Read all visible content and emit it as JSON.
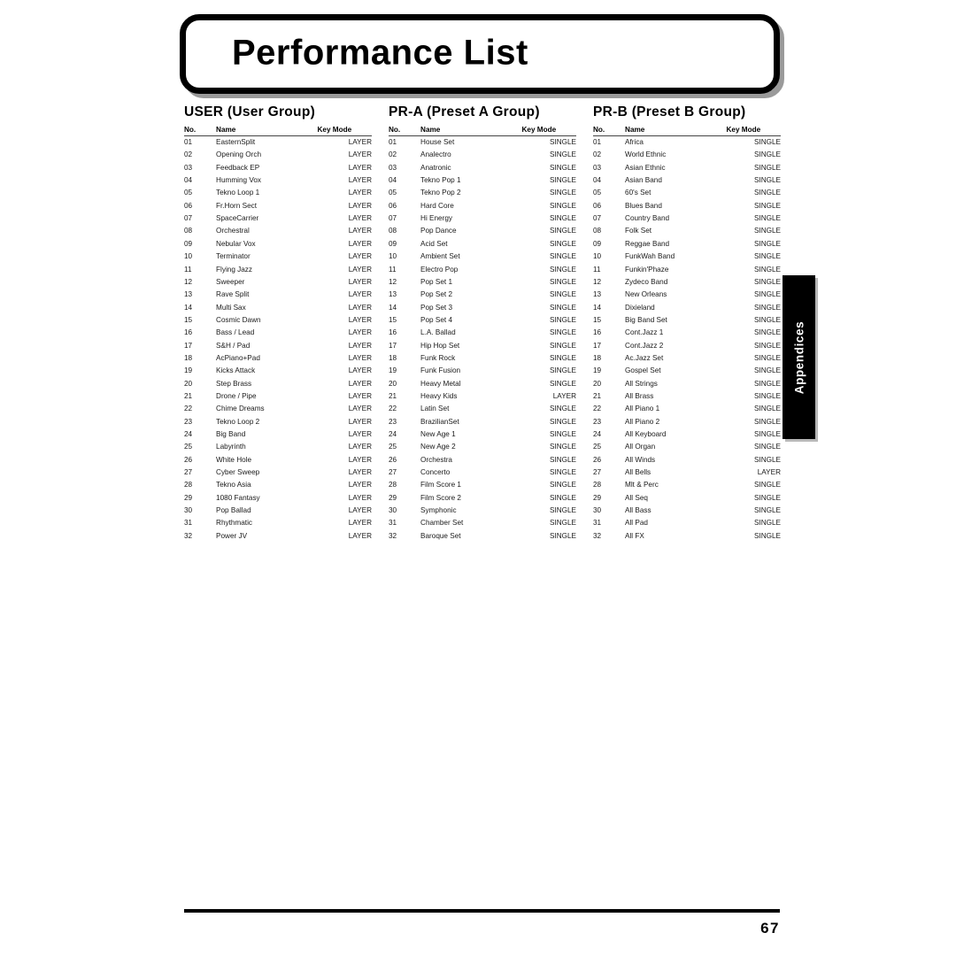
{
  "page": {
    "title": "Performance List",
    "side_tab_label": "Appendices",
    "page_number": "67"
  },
  "table_headers": {
    "no": "No.",
    "name": "Name",
    "key_mode": "Key Mode"
  },
  "groups": [
    {
      "id": "user",
      "title": "USER (User Group)",
      "rows": [
        {
          "no": "01",
          "name": "EasternSplit",
          "key": "LAYER"
        },
        {
          "no": "02",
          "name": "Opening Orch",
          "key": "LAYER"
        },
        {
          "no": "03",
          "name": "Feedback EP",
          "key": "LAYER"
        },
        {
          "no": "04",
          "name": "Humming Vox",
          "key": "LAYER"
        },
        {
          "no": "05",
          "name": "Tekno Loop 1",
          "key": "LAYER"
        },
        {
          "no": "06",
          "name": "Fr.Horn Sect",
          "key": "LAYER"
        },
        {
          "no": "07",
          "name": "SpaceCarrier",
          "key": "LAYER"
        },
        {
          "no": "08",
          "name": "Orchestral",
          "key": "LAYER"
        },
        {
          "no": "09",
          "name": "Nebular Vox",
          "key": "LAYER"
        },
        {
          "no": "10",
          "name": "Terminator",
          "key": "LAYER"
        },
        {
          "no": "11",
          "name": "Flying Jazz",
          "key": "LAYER"
        },
        {
          "no": "12",
          "name": "Sweeper",
          "key": "LAYER"
        },
        {
          "no": "13",
          "name": "Rave Split",
          "key": "LAYER"
        },
        {
          "no": "14",
          "name": "Multi Sax",
          "key": "LAYER"
        },
        {
          "no": "15",
          "name": "Cosmic Dawn",
          "key": "LAYER"
        },
        {
          "no": "16",
          "name": "Bass / Lead",
          "key": "LAYER"
        },
        {
          "no": "17",
          "name": "S&H / Pad",
          "key": "LAYER"
        },
        {
          "no": "18",
          "name": "AcPiano+Pad",
          "key": "LAYER"
        },
        {
          "no": "19",
          "name": "Kicks Attack",
          "key": "LAYER"
        },
        {
          "no": "20",
          "name": "Step Brass",
          "key": "LAYER"
        },
        {
          "no": "21",
          "name": "Drone / Pipe",
          "key": "LAYER"
        },
        {
          "no": "22",
          "name": "Chime Dreams",
          "key": "LAYER"
        },
        {
          "no": "23",
          "name": "Tekno Loop 2",
          "key": "LAYER"
        },
        {
          "no": "24",
          "name": "Big Band",
          "key": "LAYER"
        },
        {
          "no": "25",
          "name": "Labyrinth",
          "key": "LAYER"
        },
        {
          "no": "26",
          "name": "White Hole",
          "key": "LAYER"
        },
        {
          "no": "27",
          "name": "Cyber Sweep",
          "key": "LAYER"
        },
        {
          "no": "28",
          "name": "Tekno Asia",
          "key": "LAYER"
        },
        {
          "no": "29",
          "name": "1080 Fantasy",
          "key": "LAYER"
        },
        {
          "no": "30",
          "name": "Pop Ballad",
          "key": "LAYER"
        },
        {
          "no": "31",
          "name": "Rhythmatic",
          "key": "LAYER"
        },
        {
          "no": "32",
          "name": "Power JV",
          "key": "LAYER"
        }
      ]
    },
    {
      "id": "pr-a",
      "title": "PR-A (Preset A Group)",
      "rows": [
        {
          "no": "01",
          "name": "House Set",
          "key": "SINGLE"
        },
        {
          "no": "02",
          "name": "Analectro",
          "key": "SINGLE"
        },
        {
          "no": "03",
          "name": "Anatronic",
          "key": "SINGLE"
        },
        {
          "no": "04",
          "name": "Tekno Pop 1",
          "key": "SINGLE"
        },
        {
          "no": "05",
          "name": "Tekno Pop 2",
          "key": "SINGLE"
        },
        {
          "no": "06",
          "name": "Hard Core",
          "key": "SINGLE"
        },
        {
          "no": "07",
          "name": "Hi Energy",
          "key": "SINGLE"
        },
        {
          "no": "08",
          "name": "Pop Dance",
          "key": "SINGLE"
        },
        {
          "no": "09",
          "name": "Acid Set",
          "key": "SINGLE"
        },
        {
          "no": "10",
          "name": "Ambient Set",
          "key": "SINGLE"
        },
        {
          "no": "11",
          "name": "Electro Pop",
          "key": "SINGLE"
        },
        {
          "no": "12",
          "name": "Pop Set 1",
          "key": "SINGLE"
        },
        {
          "no": "13",
          "name": "Pop Set 2",
          "key": "SINGLE"
        },
        {
          "no": "14",
          "name": "Pop Set 3",
          "key": "SINGLE"
        },
        {
          "no": "15",
          "name": "Pop Set 4",
          "key": "SINGLE"
        },
        {
          "no": "16",
          "name": "L.A. Ballad",
          "key": "SINGLE"
        },
        {
          "no": "17",
          "name": "Hip Hop Set",
          "key": "SINGLE"
        },
        {
          "no": "18",
          "name": "Funk Rock",
          "key": "SINGLE"
        },
        {
          "no": "19",
          "name": "Funk Fusion",
          "key": "SINGLE"
        },
        {
          "no": "20",
          "name": "Heavy Metal",
          "key": "SINGLE"
        },
        {
          "no": "21",
          "name": "Heavy Kids",
          "key": "LAYER"
        },
        {
          "no": "22",
          "name": "Latin Set",
          "key": "SINGLE"
        },
        {
          "no": "23",
          "name": "BrazilianSet",
          "key": "SINGLE"
        },
        {
          "no": "24",
          "name": "New Age 1",
          "key": "SINGLE"
        },
        {
          "no": "25",
          "name": "New Age 2",
          "key": "SINGLE"
        },
        {
          "no": "26",
          "name": "Orchestra",
          "key": "SINGLE"
        },
        {
          "no": "27",
          "name": "Concerto",
          "key": "SINGLE"
        },
        {
          "no": "28",
          "name": "Film Score 1",
          "key": "SINGLE"
        },
        {
          "no": "29",
          "name": "Film Score 2",
          "key": "SINGLE"
        },
        {
          "no": "30",
          "name": "Symphonic",
          "key": "SINGLE"
        },
        {
          "no": "31",
          "name": "Chamber Set",
          "key": "SINGLE"
        },
        {
          "no": "32",
          "name": "Baroque Set",
          "key": "SINGLE"
        }
      ]
    },
    {
      "id": "pr-b",
      "title": "PR-B (Preset B Group)",
      "rows": [
        {
          "no": "01",
          "name": "Africa",
          "key": "SINGLE"
        },
        {
          "no": "02",
          "name": "World Ethnic",
          "key": "SINGLE"
        },
        {
          "no": "03",
          "name": "Asian Ethnic",
          "key": "SINGLE"
        },
        {
          "no": "04",
          "name": "Asian Band",
          "key": "SINGLE"
        },
        {
          "no": "05",
          "name": "60's Set",
          "key": "SINGLE"
        },
        {
          "no": "06",
          "name": "Blues Band",
          "key": "SINGLE"
        },
        {
          "no": "07",
          "name": "Country Band",
          "key": "SINGLE"
        },
        {
          "no": "08",
          "name": "Folk Set",
          "key": "SINGLE"
        },
        {
          "no": "09",
          "name": "Reggae Band",
          "key": "SINGLE"
        },
        {
          "no": "10",
          "name": "FunkWah Band",
          "key": "SINGLE"
        },
        {
          "no": "11",
          "name": "Funkin'Phaze",
          "key": "SINGLE"
        },
        {
          "no": "12",
          "name": "Zydeco Band",
          "key": "SINGLE"
        },
        {
          "no": "13",
          "name": "New Orleans",
          "key": "SINGLE"
        },
        {
          "no": "14",
          "name": "Dixieland",
          "key": "SINGLE"
        },
        {
          "no": "15",
          "name": "Big Band Set",
          "key": "SINGLE"
        },
        {
          "no": "16",
          "name": "Cont.Jazz 1",
          "key": "SINGLE"
        },
        {
          "no": "17",
          "name": "Cont.Jazz 2",
          "key": "SINGLE"
        },
        {
          "no": "18",
          "name": "Ac.Jazz Set",
          "key": "SINGLE"
        },
        {
          "no": "19",
          "name": "Gospel Set",
          "key": "SINGLE"
        },
        {
          "no": "20",
          "name": "All Strings",
          "key": "SINGLE"
        },
        {
          "no": "21",
          "name": "All Brass",
          "key": "SINGLE"
        },
        {
          "no": "22",
          "name": "All Piano 1",
          "key": "SINGLE"
        },
        {
          "no": "23",
          "name": "All Piano 2",
          "key": "SINGLE"
        },
        {
          "no": "24",
          "name": "All Keyboard",
          "key": "SINGLE"
        },
        {
          "no": "25",
          "name": "All Organ",
          "key": "SINGLE"
        },
        {
          "no": "26",
          "name": "All Winds",
          "key": "SINGLE"
        },
        {
          "no": "27",
          "name": "All Bells",
          "key": "LAYER"
        },
        {
          "no": "28",
          "name": "Mlt & Perc",
          "key": "SINGLE"
        },
        {
          "no": "29",
          "name": "All Seq",
          "key": "SINGLE"
        },
        {
          "no": "30",
          "name": "All Bass",
          "key": "SINGLE"
        },
        {
          "no": "31",
          "name": "All Pad",
          "key": "SINGLE"
        },
        {
          "no": "32",
          "name": "All FX",
          "key": "SINGLE"
        }
      ]
    }
  ]
}
